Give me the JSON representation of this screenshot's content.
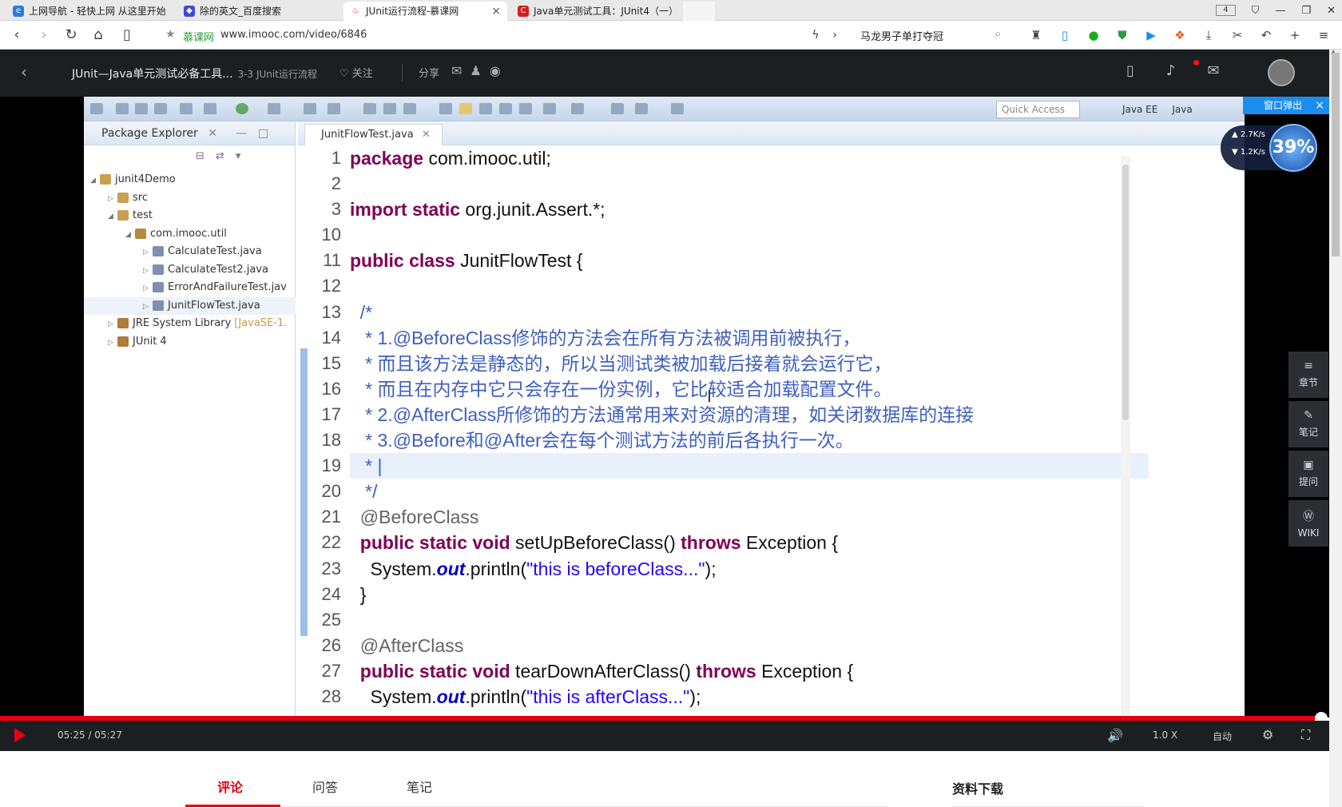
{
  "tabs": [
    {
      "title": "上网导航 - 轻快上网 从这里开始",
      "icon": "e"
    },
    {
      "title": "除的英文_百度搜索",
      "icon": "du"
    },
    {
      "title": "JUnit运行流程-慕课网",
      "icon": "mk"
    },
    {
      "title": "Java单元测试工具：JUnit4（一）",
      "icon": "c"
    }
  ],
  "tab_count": "4",
  "address": {
    "site": "慕课网",
    "url": "www.imooc.com/video/6846",
    "search_hint": "马龙男子单打夺冠"
  },
  "header": {
    "course_title": "JUnit—Java单元测试必备工具...",
    "lesson": "3-3 JUnit运行流程",
    "follow": "关注",
    "share": "分享"
  },
  "eclipse": {
    "quick_access": "Quick Access",
    "perspectives": [
      "Java EE",
      "Java"
    ],
    "package_explorer": {
      "title": "Package Explorer",
      "tree": [
        {
          "label": "junit4Demo",
          "depth": 0
        },
        {
          "label": "src",
          "depth": 1
        },
        {
          "label": "test",
          "depth": 1
        },
        {
          "label": "com.imooc.util",
          "depth": 2
        },
        {
          "label": "CalculateTest.java",
          "depth": 3
        },
        {
          "label": "CalculateTest2.java",
          "depth": 3
        },
        {
          "label": "ErrorAndFailureTest.jav",
          "depth": 3
        },
        {
          "label": "JunitFlowTest.java",
          "depth": 3
        },
        {
          "label": "JRE System Library",
          "extra": "[JavaSE-1.",
          "depth": 1
        },
        {
          "label": "JUnit 4",
          "depth": 1
        }
      ]
    },
    "editor_tab": "JunitFlowTest.java",
    "line_numbers": [
      "1",
      "2",
      "3",
      "10",
      "11",
      "12",
      "13",
      "14",
      "15",
      "16",
      "17",
      "18",
      "19",
      "20",
      "21",
      "22",
      "23",
      "24",
      "25",
      "26",
      "27",
      "28"
    ],
    "code": [
      "package com.imooc.util;",
      "",
      "import static org.junit.Assert.*;",
      "",
      "public class JunitFlowTest {",
      "",
      "  /*",
      "   * 1.@BeforeClass修饰的方法会在所有方法被调用前被执行，",
      "   * 而且该方法是静态的，所以当测试类被加载后接着就会运行它，",
      "   * 而且在内存中它只会存在一份实例，它比较适合加载配置文件。",
      "   * 2.@AfterClass所修饰的方法通常用来对资源的清理，如关闭数据库的连接",
      "   * 3.@Before和@After会在每个测试方法的前后各执行一次。",
      "   * |",
      "   */",
      "  @BeforeClass",
      "  public static void setUpBeforeClass() throws Exception {",
      "    System.out.println(\"this is beforeClass...\");",
      "  }",
      "",
      "  @AfterClass",
      "  public static void tearDownAfterClass() throws Exception {",
      "    System.out.println(\"this is afterClass...\");"
    ]
  },
  "popup": {
    "label": "窗口弹出"
  },
  "speed": {
    "up": "2.7K/s",
    "down": "1.2K/s",
    "percent": "39%"
  },
  "side_buttons": [
    "章节",
    "笔记",
    "提问",
    "WIKI"
  ],
  "player": {
    "time": "05:25 / 05:27",
    "rate": "1.0 X",
    "quality": "自动",
    "progress": 0.994
  },
  "bottom": {
    "tabs": [
      "评论",
      "问答",
      "笔记"
    ],
    "download": "资料下载"
  }
}
